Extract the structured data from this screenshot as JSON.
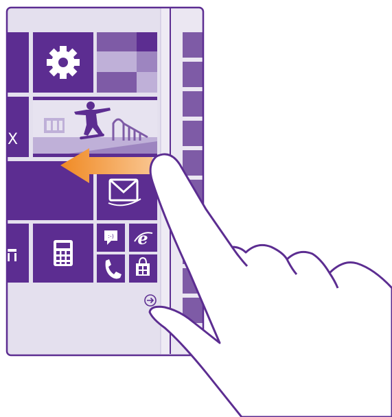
{
  "colors": {
    "screen_background": "#e4e0ee",
    "tile_purple": "#5c2d91",
    "tile_purple_mid": "#7e5ba6",
    "tile_purple_light": "#9d85c0",
    "tile_purple_pale": "#bfb0d8",
    "phone_outline": "#5c2d91",
    "arrow_orange": "#f5a35b",
    "arrow_orange_dark": "#f08a24",
    "hand_fill": "#ffffff",
    "hand_outline": "#5c2d91"
  },
  "tiles": [
    {
      "name": "tile-left-top",
      "icon": "none"
    },
    {
      "name": "tile-settings",
      "icon": "gear-icon"
    },
    {
      "name": "tile-photos",
      "icon": "mosaic"
    },
    {
      "name": "tile-xbox-partial",
      "label": "X"
    },
    {
      "name": "tile-photo-skateboarder",
      "icon": "skateboarder-photo"
    },
    {
      "name": "tile-wide-left",
      "icon": "none"
    },
    {
      "name": "tile-outlook-mail",
      "icon": "mail-icon"
    },
    {
      "name": "tile-store-partial",
      "icon": "store-partial-icon"
    },
    {
      "name": "tile-calculator",
      "icon": "calculator-icon"
    },
    {
      "name": "tile-messaging",
      "icon": "message-icon",
      "glyph": ":-)"
    },
    {
      "name": "tile-internet-explorer",
      "icon": "ie-icon",
      "glyph": "e"
    },
    {
      "name": "tile-phone",
      "icon": "phone-icon"
    },
    {
      "name": "tile-store",
      "icon": "store-icon"
    }
  ],
  "all_apps_arrow": {
    "icon": "arrow-right-circle-icon"
  },
  "gesture": {
    "direction": "left",
    "icon": "swipe-arrow-left"
  }
}
